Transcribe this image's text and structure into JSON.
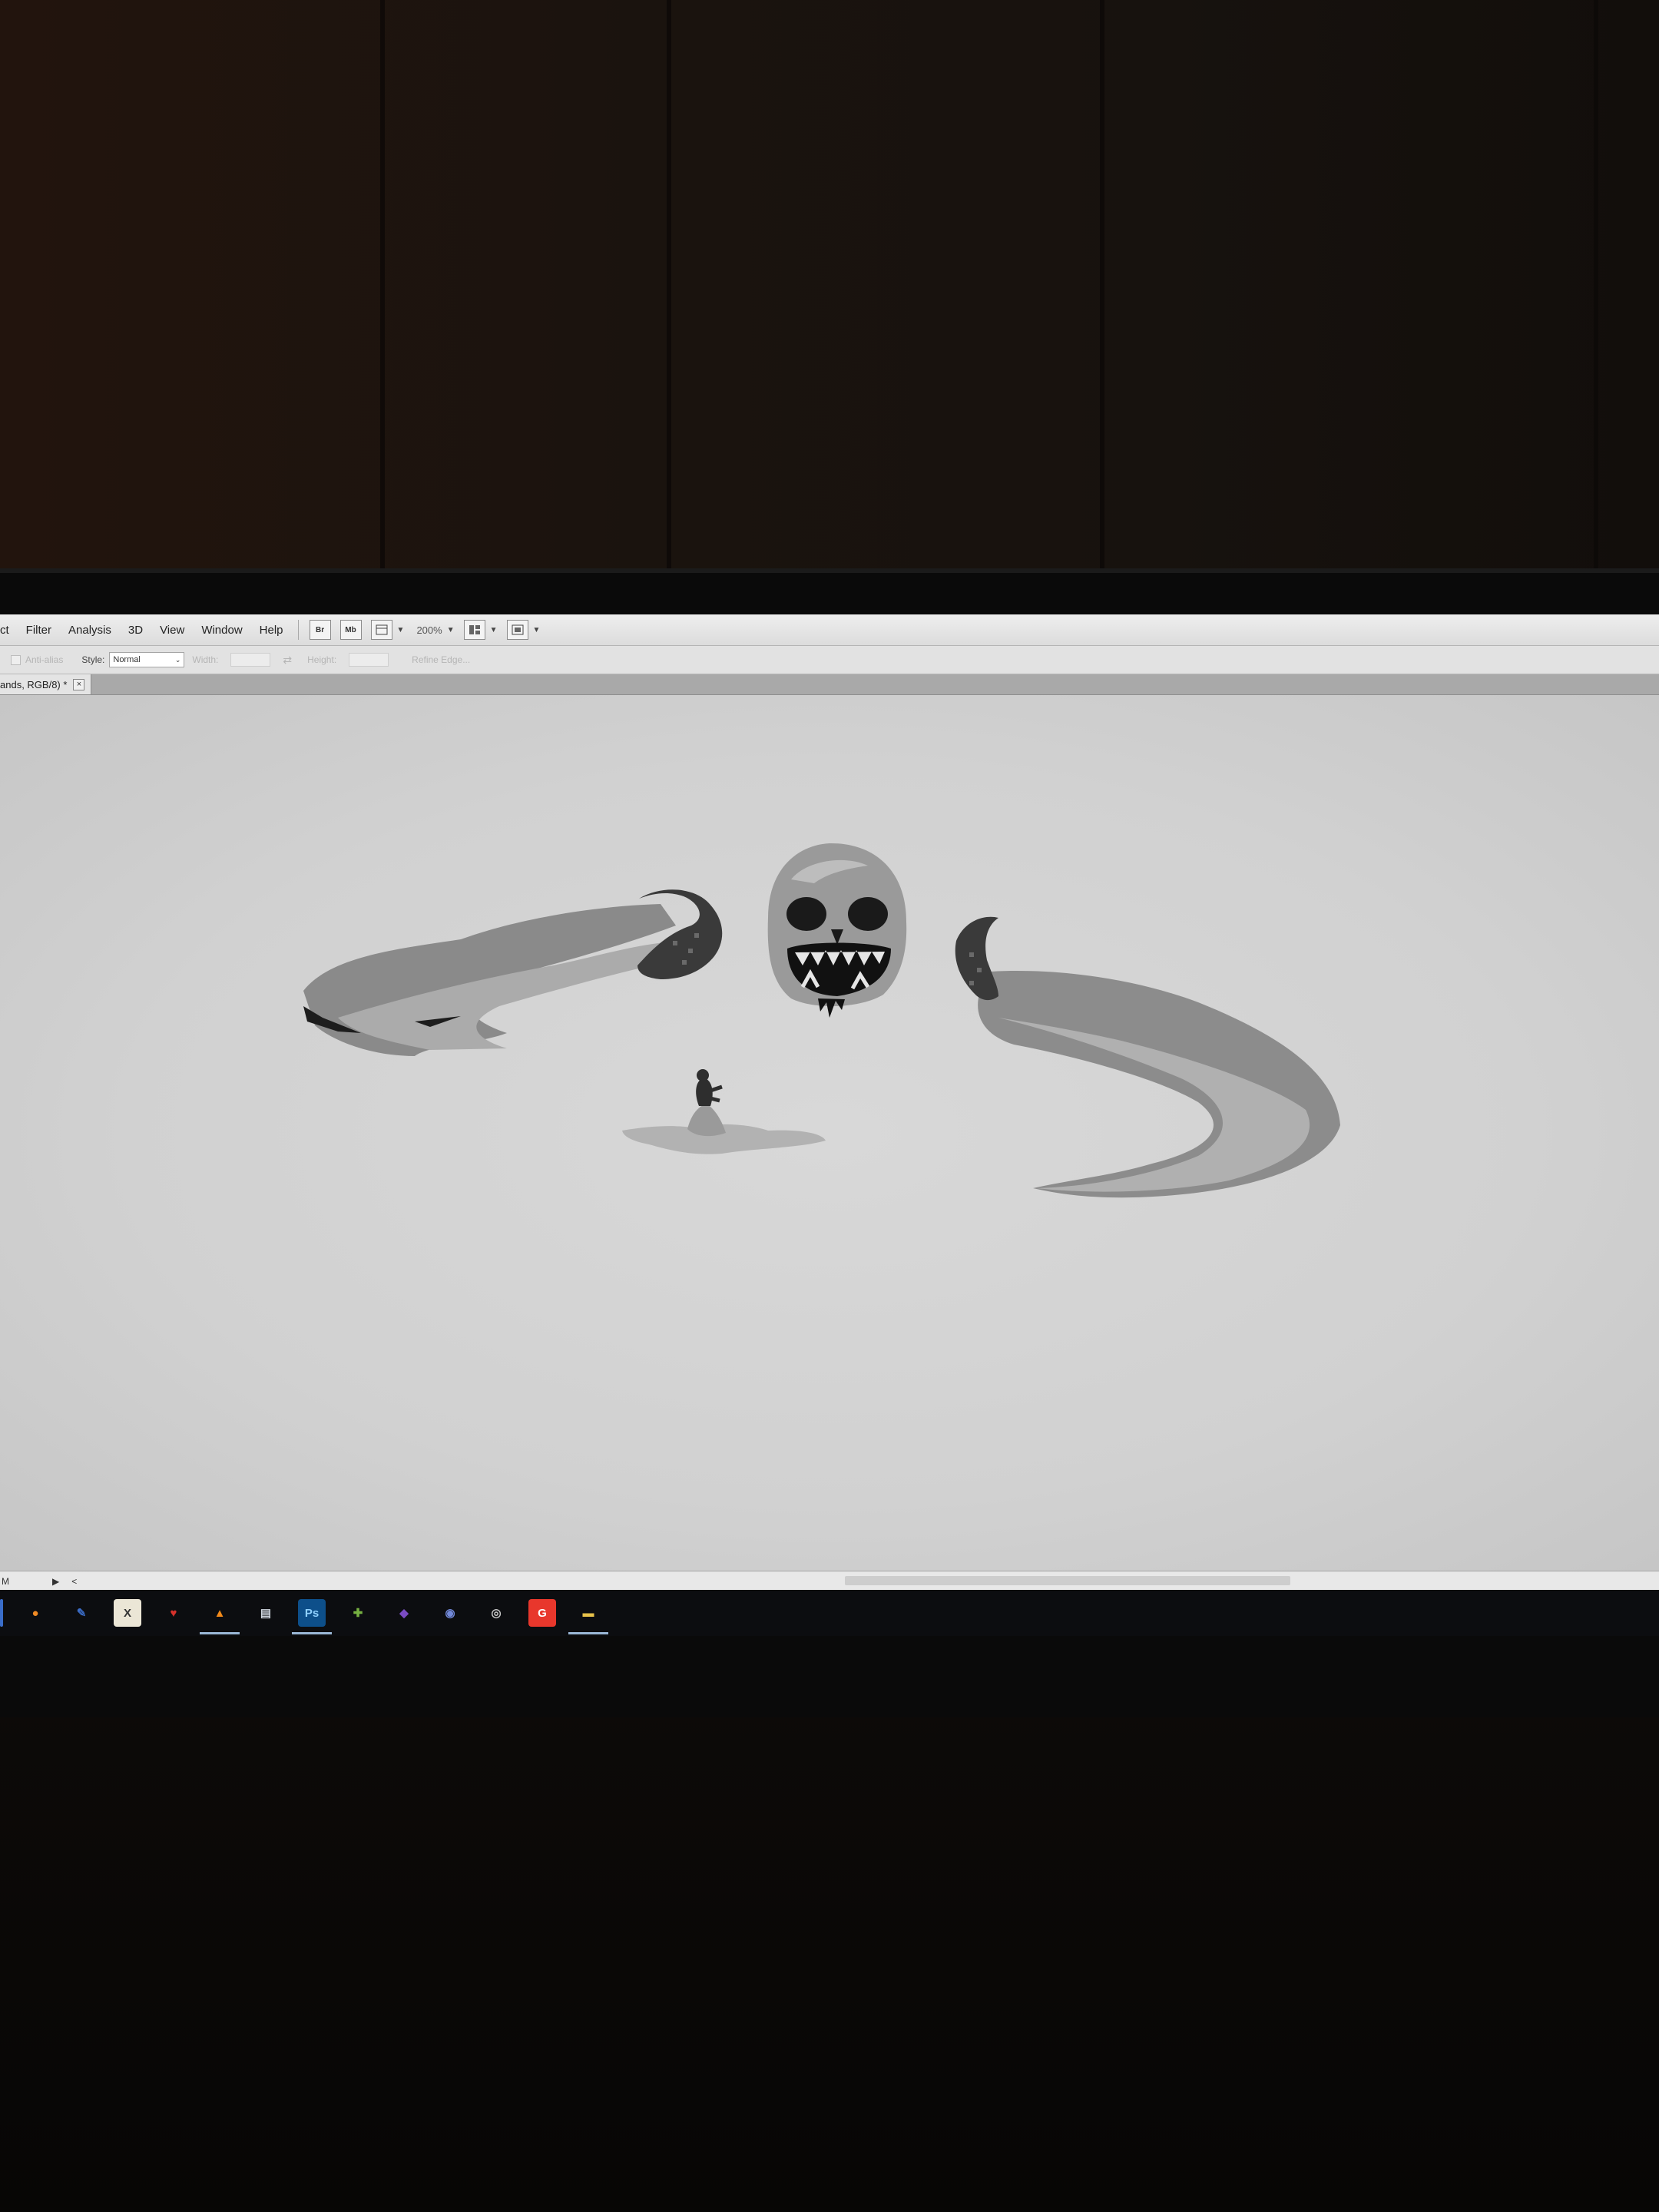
{
  "menu": {
    "items": [
      "ct",
      "Filter",
      "Analysis",
      "3D",
      "View",
      "Window",
      "Help"
    ]
  },
  "toolbar": {
    "buttons": [
      "Br",
      "Mb"
    ],
    "zoom": "200%"
  },
  "options": {
    "antialias_label": "Anti-alias",
    "style_label": "Style:",
    "style_value": "Normal",
    "width_label": "Width:",
    "height_label": "Height:",
    "refine_edge_label": "Refine Edge..."
  },
  "document": {
    "tab_title": "ands, RGB/8) *",
    "tab_close": "×"
  },
  "statusbar": {
    "zoom_fragment": "M",
    "next_arrow": "▶",
    "prev_arrow": "<"
  },
  "taskbar": {
    "apps": [
      {
        "icon": "blender-icon",
        "glyph": "●",
        "color": "#f08a24"
      },
      {
        "icon": "paint-tool-icon",
        "glyph": "✎",
        "color": "#3b6cc7"
      },
      {
        "icon": "excel-icon",
        "glyph": "X",
        "color": "#ebe6d6"
      },
      {
        "icon": "red-app-icon",
        "glyph": "♥",
        "color": "#d6312b"
      },
      {
        "icon": "vlc-icon",
        "glyph": "▲",
        "color": "#f28a1a"
      },
      {
        "icon": "explorer-files-icon",
        "glyph": "▤",
        "color": "#cfd6df"
      },
      {
        "icon": "photoshop-icon",
        "glyph": "Ps",
        "color": "#0d4f8a"
      },
      {
        "icon": "notepad-plus-icon",
        "glyph": "✚",
        "color": "#76b041"
      },
      {
        "icon": "visual-studio-icon",
        "glyph": "◆",
        "color": "#7a4bc2"
      },
      {
        "icon": "discord-icon",
        "glyph": "◉",
        "color": "#7289da"
      },
      {
        "icon": "obs-icon",
        "glyph": "◎",
        "color": "#2b2b2b"
      },
      {
        "icon": "gamemaker-icon",
        "glyph": "G",
        "color": "#e8372c"
      },
      {
        "icon": "folder-icon",
        "glyph": "▬",
        "color": "#e7c14a"
      }
    ]
  },
  "colors": {
    "ui_light": "#e8e8e8",
    "canvas": "#d4d4d4",
    "taskbar": "#0c0d10",
    "active_indicator": "#9ab7d6"
  }
}
